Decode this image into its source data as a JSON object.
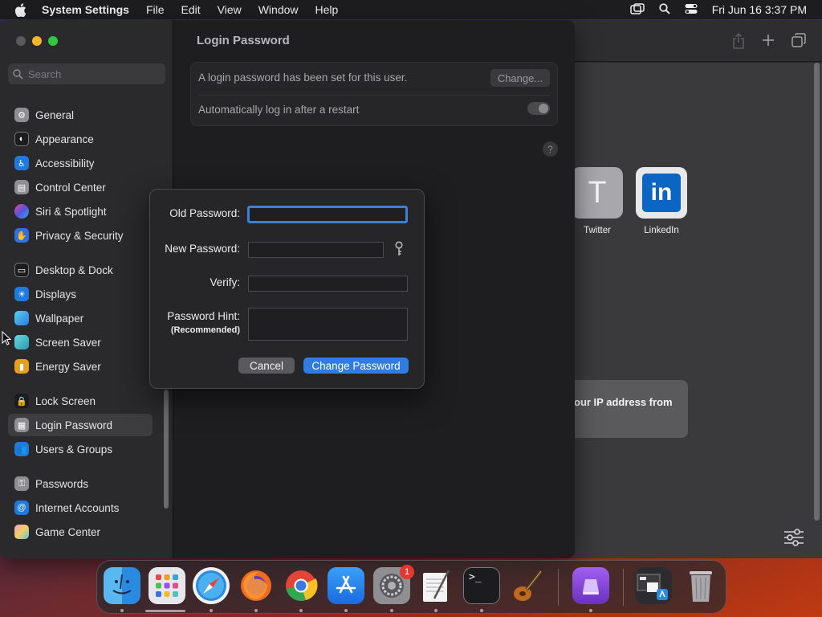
{
  "menubar": {
    "app_name": "System Settings",
    "menus": [
      "File",
      "Edit",
      "View",
      "Window",
      "Help"
    ],
    "clock": "Fri Jun 16  3:37 PM"
  },
  "sidebar": {
    "search_placeholder": "Search",
    "items": [
      {
        "label": "General",
        "icon": "gear-icon",
        "color": "#8e8e93"
      },
      {
        "label": "Appearance",
        "icon": "appearance-icon",
        "color": "#3a3a3c"
      },
      {
        "label": "Accessibility",
        "icon": "accessibility-icon",
        "color": "#1f7ae0"
      },
      {
        "label": "Control Center",
        "icon": "control-center-icon",
        "color": "#8e8e93"
      },
      {
        "label": "Siri & Spotlight",
        "icon": "siri-icon",
        "color": "#b04fd8"
      },
      {
        "label": "Privacy & Security",
        "icon": "hand-icon",
        "color": "#2f6fe0"
      },
      {
        "label": "Desktop & Dock",
        "icon": "dock-icon",
        "color": "#2c2c2e"
      },
      {
        "label": "Displays",
        "icon": "sun-icon",
        "color": "#1f7ae0"
      },
      {
        "label": "Wallpaper",
        "icon": "wallpaper-icon",
        "color": "#2ea0e0"
      },
      {
        "label": "Screen Saver",
        "icon": "screen-saver-icon",
        "color": "#3bb0c8"
      },
      {
        "label": "Energy Saver",
        "icon": "battery-icon",
        "color": "#e5a020"
      },
      {
        "label": "Lock Screen",
        "icon": "lock-icon",
        "color": "#2c2c2e"
      },
      {
        "label": "Login Password",
        "icon": "login-password-icon",
        "color": "#8e8e93"
      },
      {
        "label": "Users & Groups",
        "icon": "users-icon",
        "color": "#1f7ae0"
      },
      {
        "label": "Passwords",
        "icon": "key-icon",
        "color": "#8e8e93"
      },
      {
        "label": "Internet Accounts",
        "icon": "at-icon",
        "color": "#1f7ae0"
      },
      {
        "label": "Game Center",
        "icon": "game-center-icon",
        "color": "#e5a0c0"
      }
    ],
    "selected": "Login Password"
  },
  "content": {
    "title": "Login Password",
    "row1_text": "A login password has been set for this user.",
    "change_button": "Change...",
    "row2_text": "Automatically log in after a restart",
    "autologin_enabled": false,
    "help_label": "?"
  },
  "sheet": {
    "old_password_label": "Old Password:",
    "new_password_label": "New Password:",
    "verify_label": "Verify:",
    "hint_label": "Password Hint:",
    "hint_sublabel": "(Recommended)",
    "old_password_value": "",
    "new_password_value": "",
    "verify_value": "",
    "hint_value": "",
    "cancel_button": "Cancel",
    "submit_button": "Change Password"
  },
  "browser": {
    "favorites": [
      {
        "label": "Twitter",
        "letter": "T"
      },
      {
        "label": "LinkedIn",
        "letter": "in"
      }
    ],
    "privacy_card_text": "our IP address from"
  },
  "dock": {
    "apps": [
      "Finder",
      "Launchpad",
      "Safari",
      "Firefox",
      "Chrome",
      "App Store",
      "System Settings",
      "TextEdit",
      "Terminal",
      "GarageBand",
      "Podcasts Utility",
      "Downloads",
      "Trash"
    ],
    "settings_badge": "1"
  },
  "colors": {
    "accent": "#2f7de0",
    "focus_ring": "#3b82d6",
    "badge": "#e5372f"
  }
}
